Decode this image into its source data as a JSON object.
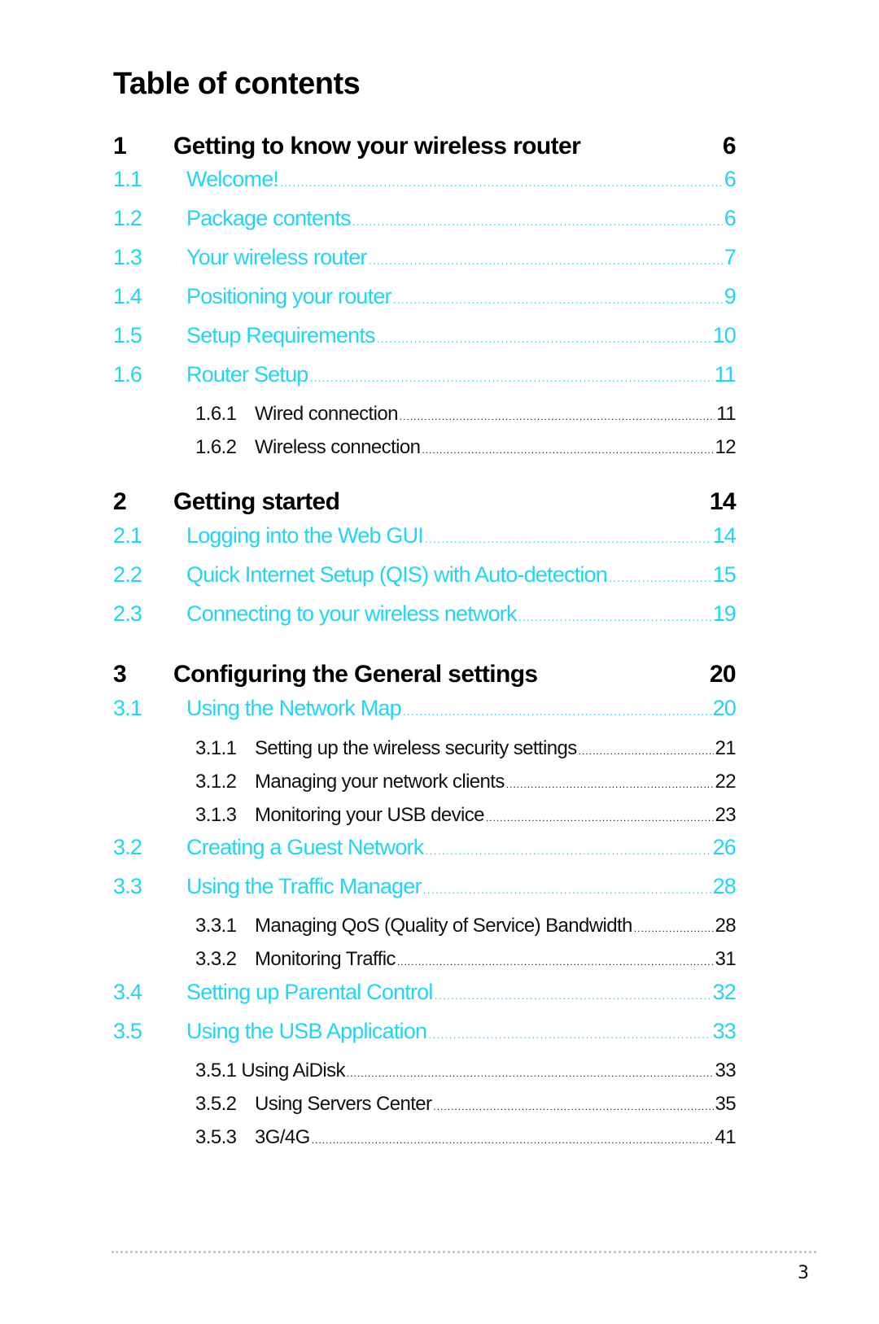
{
  "title": "Table of contents",
  "colors": {
    "section": "#21d6f5",
    "chapter": "#000000",
    "subsection": "#111111"
  },
  "entries": [
    {
      "level": "chapter",
      "num": "1",
      "label": "Getting to know your wireless router",
      "page": "6"
    },
    {
      "level": "section",
      "num": "1.1",
      "label": "Welcome!",
      "page": "6"
    },
    {
      "level": "section",
      "num": "1.2",
      "label": "Package contents",
      "page": "6"
    },
    {
      "level": "section",
      "num": "1.3",
      "label": "Your wireless router",
      "page": "7"
    },
    {
      "level": "section",
      "num": "1.4",
      "label": "Positioning your router",
      "page": "9"
    },
    {
      "level": "section",
      "num": "1.5",
      "label": "Setup Requirements",
      "page": "10"
    },
    {
      "level": "section",
      "num": "1.6",
      "label": "Router Setup",
      "page": "11"
    },
    {
      "level": "sub",
      "num": "1.6.1",
      "label": "Wired connection",
      "page": "11"
    },
    {
      "level": "sub",
      "num": "1.6.2",
      "label": "Wireless connection",
      "page": "12"
    },
    {
      "level": "chapter",
      "num": "2",
      "label": "Getting started",
      "page": "14"
    },
    {
      "level": "section",
      "num": "2.1",
      "label": "Logging into the Web GUI",
      "page": "14"
    },
    {
      "level": "section",
      "num": "2.2",
      "label": "Quick Internet Setup (QIS) with Auto-detection",
      "page": "15"
    },
    {
      "level": "section",
      "num": "2.3",
      "label": "Connecting to your wireless network",
      "page": "19"
    },
    {
      "level": "chapter",
      "num": "3",
      "label": "Configuring the General settings",
      "page": "20"
    },
    {
      "level": "section",
      "num": "3.1",
      "label": "Using the Network Map",
      "page": "20"
    },
    {
      "level": "sub",
      "num": "3.1.1",
      "label": "Setting up the wireless security settings",
      "page": "21"
    },
    {
      "level": "sub",
      "num": "3.1.2",
      "label": "Managing your network clients",
      "page": "22"
    },
    {
      "level": "sub",
      "num": "3.1.3",
      "label": "Monitoring your USB device",
      "page": "23"
    },
    {
      "level": "section",
      "num": "3.2",
      "label": "Creating a Guest Network",
      "page": "26"
    },
    {
      "level": "section",
      "num": "3.3",
      "label": "Using the Traffic Manager",
      "page": "28"
    },
    {
      "level": "sub",
      "num": "3.3.1",
      "label": "Managing QoS (Quality of Service) Bandwidth",
      "page": "28"
    },
    {
      "level": "sub",
      "num": "3.3.2",
      "label": "Monitoring Traffic",
      "page": "31"
    },
    {
      "level": "section",
      "num": "3.4",
      "label": "Setting up Parental Control",
      "page": "32"
    },
    {
      "level": "section",
      "num": "3.5",
      "label": "Using the USB Application",
      "page": "33"
    },
    {
      "level": "sub",
      "num": "3.5.1",
      "label": "Using AiDisk",
      "page": "33"
    },
    {
      "level": "sub",
      "num": "3.5.2",
      "label": "Using Servers Center",
      "page": "35"
    },
    {
      "level": "sub",
      "num": "3.5.3",
      "label": "3G/4G",
      "page": "41"
    }
  ],
  "footer": {
    "page_number": "3"
  }
}
